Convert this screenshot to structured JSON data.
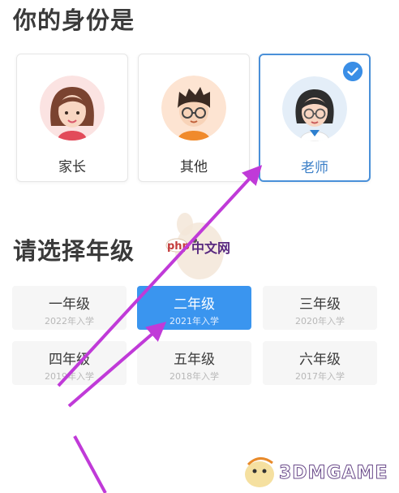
{
  "identity": {
    "title": "你的身份是",
    "options": [
      {
        "label": "家长",
        "selected": false
      },
      {
        "label": "其他",
        "selected": false
      },
      {
        "label": "老师",
        "selected": true
      }
    ]
  },
  "grade": {
    "title": "请选择年级",
    "options": [
      {
        "name": "一年级",
        "year": "2022年入学",
        "selected": false
      },
      {
        "name": "二年级",
        "year": "2021年入学",
        "selected": true
      },
      {
        "name": "三年级",
        "year": "2020年入学",
        "selected": false
      },
      {
        "name": "四年级",
        "year": "2019年入学",
        "selected": false
      },
      {
        "name": "五年级",
        "year": "2018年入学",
        "selected": false
      },
      {
        "name": "六年级",
        "year": "2017年入学",
        "selected": false
      }
    ]
  },
  "watermarks": {
    "php": "php",
    "cn": "中文网",
    "game": "3DMGAME"
  },
  "colors": {
    "accent": "#3a95ef",
    "arrow": "#c03ad8"
  }
}
